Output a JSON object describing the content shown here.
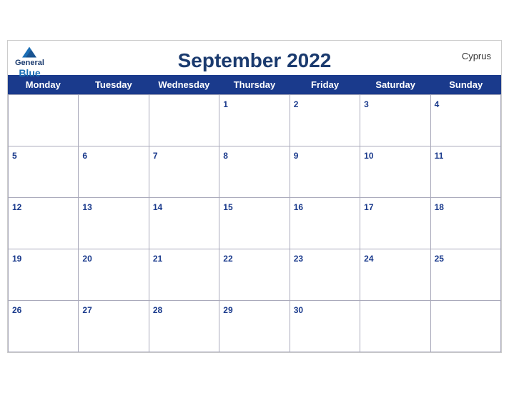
{
  "header": {
    "title": "September 2022",
    "logo_general": "General",
    "logo_blue": "Blue",
    "country": "Cyprus"
  },
  "weekdays": [
    "Monday",
    "Tuesday",
    "Wednesday",
    "Thursday",
    "Friday",
    "Saturday",
    "Sunday"
  ],
  "rows": [
    [
      {
        "date": "",
        "empty": true
      },
      {
        "date": "",
        "empty": true
      },
      {
        "date": "",
        "empty": true
      },
      {
        "date": "1"
      },
      {
        "date": "2"
      },
      {
        "date": "3"
      },
      {
        "date": "4"
      }
    ],
    [
      {
        "date": "5"
      },
      {
        "date": "6"
      },
      {
        "date": "7"
      },
      {
        "date": "8"
      },
      {
        "date": "9"
      },
      {
        "date": "10"
      },
      {
        "date": "11"
      }
    ],
    [
      {
        "date": "12"
      },
      {
        "date": "13"
      },
      {
        "date": "14"
      },
      {
        "date": "15"
      },
      {
        "date": "16"
      },
      {
        "date": "17"
      },
      {
        "date": "18"
      }
    ],
    [
      {
        "date": "19"
      },
      {
        "date": "20"
      },
      {
        "date": "21"
      },
      {
        "date": "22"
      },
      {
        "date": "23"
      },
      {
        "date": "24"
      },
      {
        "date": "25"
      }
    ],
    [
      {
        "date": "26"
      },
      {
        "date": "27"
      },
      {
        "date": "28"
      },
      {
        "date": "29"
      },
      {
        "date": "30"
      },
      {
        "date": "",
        "empty": true
      },
      {
        "date": "",
        "empty": true
      }
    ]
  ],
  "accent_color": "#1a3a8c",
  "text_color": "#1a3a6e"
}
